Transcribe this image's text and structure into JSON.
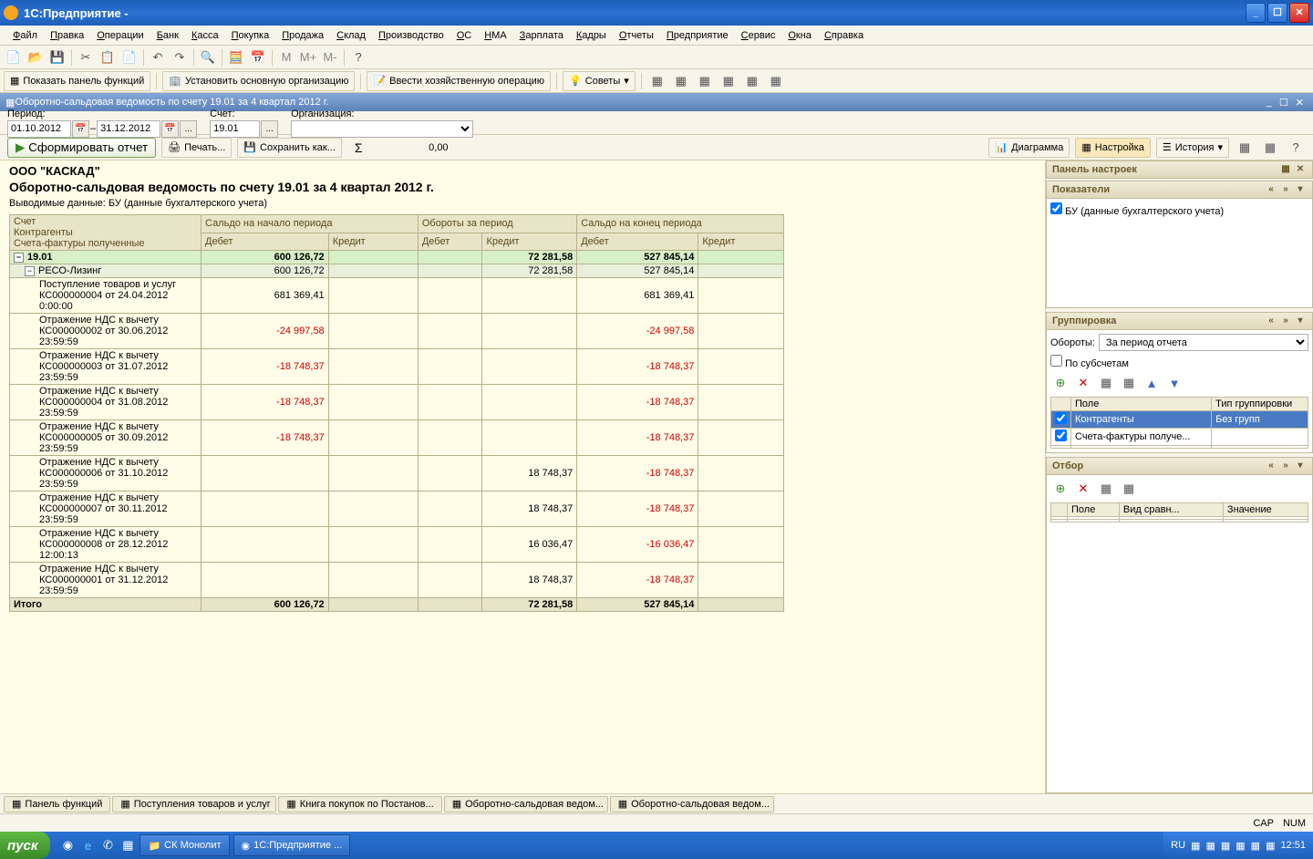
{
  "window": {
    "title": "1С:Предприятие -"
  },
  "menu": [
    "Файл",
    "Правка",
    "Операции",
    "Банк",
    "Касса",
    "Покупка",
    "Продажа",
    "Склад",
    "Производство",
    "ОС",
    "НМА",
    "Зарплата",
    "Кадры",
    "Отчеты",
    "Предприятие",
    "Сервис",
    "Окна",
    "Справка"
  ],
  "toolbar2": {
    "show_panel": "Показать панель функций",
    "set_org": "Установить основную организацию",
    "enter_op": "Ввести хозяйственную операцию",
    "tips": "Советы"
  },
  "doc": {
    "title": "Оборотно-сальдовая ведомость по счету 19.01 за 4 квартал 2012 г.",
    "period_label": "Период:",
    "period_from": "01.10.2012",
    "period_to": "31.12.2012",
    "account_label": "Счет:",
    "account": "19.01",
    "org_label": "Организация:",
    "org": ""
  },
  "actions": {
    "generate": "Сформировать отчет",
    "print": "Печать...",
    "save_as": "Сохранить как...",
    "sum": "0,00",
    "chart": "Диаграмма",
    "settings": "Настройка",
    "history": "История"
  },
  "report": {
    "org": "ООО \"КАСКАД\"",
    "title": "Оборотно-сальдовая ведомость по счету 19.01 за 4 квартал 2012 г.",
    "subtitle": "Выводимые данные:  БУ (данные бухгалтерского учета)",
    "headers": {
      "account": "Счет",
      "contractors": "Контрагенты",
      "invoices": "Счета-фактуры полученные",
      "open_bal": "Сальдо на начало периода",
      "turnover": "Обороты за период",
      "close_bal": "Сальдо на конец периода",
      "debit": "Дебет",
      "credit": "Кредит"
    },
    "rows": [
      {
        "type": "acct",
        "label": "19.01",
        "ob_d": "600 126,72",
        "ob_c": "",
        "tv_d": "",
        "tv_c": "72 281,58",
        "cb_d": "527 845,14",
        "cb_c": ""
      },
      {
        "type": "contr",
        "label": "РЕСО-Лизинг",
        "ob_d": "600 126,72",
        "ob_c": "",
        "tv_d": "",
        "tv_c": "72 281,58",
        "cb_d": "527 845,14",
        "cb_c": ""
      },
      {
        "type": "doc",
        "label": "Поступление товаров и услуг КС000000004 от 24.04.2012 0:00:00",
        "ob_d": "681 369,41",
        "ob_c": "",
        "tv_d": "",
        "tv_c": "",
        "cb_d": "681 369,41",
        "cb_c": ""
      },
      {
        "type": "doc",
        "label": "Отражение НДС к вычету КС000000002 от 30.06.2012 23:59:59",
        "ob_d": "-24 997,58",
        "ob_c": "",
        "tv_d": "",
        "tv_c": "",
        "cb_d": "-24 997,58",
        "cb_c": "",
        "neg": true
      },
      {
        "type": "doc",
        "label": "Отражение НДС к вычету КС000000003 от 31.07.2012 23:59:59",
        "ob_d": "-18 748,37",
        "ob_c": "",
        "tv_d": "",
        "tv_c": "",
        "cb_d": "-18 748,37",
        "cb_c": "",
        "neg": true
      },
      {
        "type": "doc",
        "label": "Отражение НДС к вычету КС000000004 от 31.08.2012 23:59:59",
        "ob_d": "-18 748,37",
        "ob_c": "",
        "tv_d": "",
        "tv_c": "",
        "cb_d": "-18 748,37",
        "cb_c": "",
        "neg": true
      },
      {
        "type": "doc",
        "label": "Отражение НДС к вычету КС000000005 от 30.09.2012 23:59:59",
        "ob_d": "-18 748,37",
        "ob_c": "",
        "tv_d": "",
        "tv_c": "",
        "cb_d": "-18 748,37",
        "cb_c": "",
        "neg": true
      },
      {
        "type": "doc",
        "label": "Отражение НДС к вычету КС000000006 от 31.10.2012 23:59:59",
        "ob_d": "",
        "ob_c": "",
        "tv_d": "",
        "tv_c": "18 748,37",
        "cb_d": "-18 748,37",
        "cb_c": "",
        "neg": true
      },
      {
        "type": "doc",
        "label": "Отражение НДС к вычету КС000000007 от 30.11.2012 23:59:59",
        "ob_d": "",
        "ob_c": "",
        "tv_d": "",
        "tv_c": "18 748,37",
        "cb_d": "-18 748,37",
        "cb_c": "",
        "neg": true
      },
      {
        "type": "doc",
        "label": "Отражение НДС к вычету КС000000008 от 28.12.2012 12:00:13",
        "ob_d": "",
        "ob_c": "",
        "tv_d": "",
        "tv_c": "16 036,47",
        "cb_d": "-16 036,47",
        "cb_c": "",
        "neg": true
      },
      {
        "type": "doc",
        "label": "Отражение НДС к вычету КС000000001 от 31.12.2012 23:59:59",
        "ob_d": "",
        "ob_c": "",
        "tv_d": "",
        "tv_c": "18 748,37",
        "cb_d": "-18 748,37",
        "cb_c": "",
        "neg": true
      }
    ],
    "total": {
      "label": "Итого",
      "ob_d": "600 126,72",
      "ob_c": "",
      "tv_d": "",
      "tv_c": "72 281,58",
      "cb_d": "527 845,14",
      "cb_c": ""
    }
  },
  "right": {
    "panel_title": "Панель настроек",
    "indicators": "Показатели",
    "bu_label": "БУ (данные бухгалтерского учета)",
    "grouping": "Группировка",
    "turnover_label": "Обороты:",
    "turnover_value": "За период отчета",
    "by_subaccounts": "По субсчетам",
    "col_field": "Поле",
    "col_grptype": "Тип группировки",
    "grp_rows": [
      {
        "field": "Контрагенты",
        "type": "Без групп",
        "sel": true
      },
      {
        "field": "Счета-фактуры получе...",
        "type": ""
      }
    ],
    "filter": "Отбор",
    "flt_field": "Поле",
    "flt_cmp": "Вид сравн...",
    "flt_val": "Значение"
  },
  "tabs": [
    "Панель функций",
    "Поступления товаров и услуг",
    "Книга покупок по Постанов...",
    "Оборотно-сальдовая ведом...",
    "Оборотно-сальдовая ведом..."
  ],
  "status": {
    "cap": "CAP",
    "num": "NUM"
  },
  "wintask": {
    "start": "пуск",
    "t1": "СК Монолит",
    "t2": "1С:Предприятие ...",
    "lang": "RU",
    "clock": "12:51"
  }
}
